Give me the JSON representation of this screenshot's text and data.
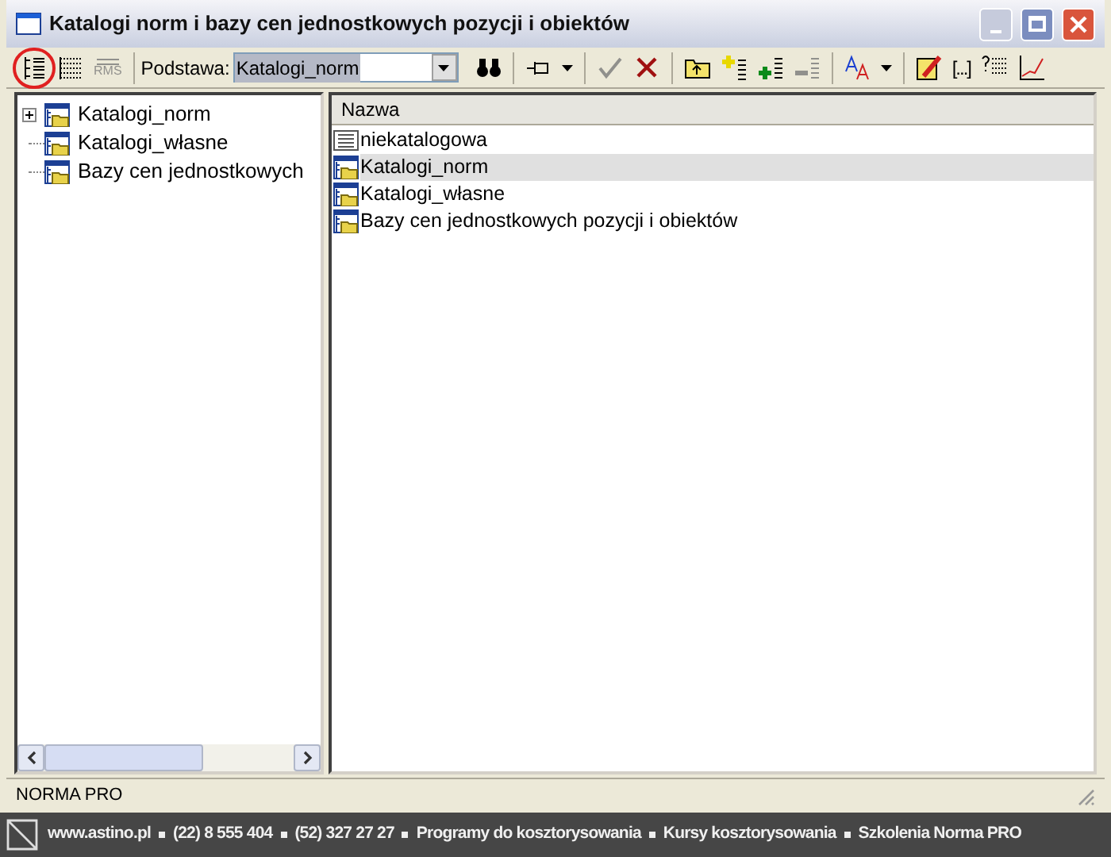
{
  "window": {
    "title": "Katalogi norm i bazy cen jednostkowych pozycji i obiektów"
  },
  "toolbar": {
    "groups": [
      [
        {
          "kind": "tree",
          "disabled": false,
          "circled": true
        },
        {
          "kind": "grid",
          "disabled": false,
          "circled": false
        },
        {
          "kind": "rms",
          "label": "RMS",
          "disabled": true,
          "circled": false
        }
      ],
      [
        {
          "kind": "base"
        }
      ],
      [
        {
          "kind": "pin",
          "dropdown": true,
          "disabled": false,
          "circled": false
        }
      ],
      [
        {
          "kind": "check",
          "disabled": true,
          "circled": false
        },
        {
          "kind": "cross",
          "disabled": false,
          "circled": false
        }
      ],
      [
        {
          "kind": "folder-up",
          "disabled": false,
          "circled": false
        },
        {
          "kind": "add-yellow",
          "disabled": false,
          "circled": false
        },
        {
          "kind": "add-green",
          "disabled": false,
          "circled": false
        },
        {
          "kind": "remove",
          "disabled": true,
          "circled": false
        }
      ],
      [
        {
          "kind": "font",
          "dropdown": true,
          "disabled": false,
          "circled": false
        }
      ],
      [
        {
          "kind": "edit",
          "disabled": false,
          "circled": false
        },
        {
          "kind": "brackets",
          "label": "[...]",
          "disabled": false,
          "circled": false
        },
        {
          "kind": "query",
          "disabled": false,
          "circled": false
        },
        {
          "kind": "chart",
          "disabled": false,
          "circled": false
        }
      ]
    ],
    "base_label": "Podstawa:",
    "base_value": "Katalogi_norm"
  },
  "tree": {
    "items": [
      {
        "label": "Katalogi_norm",
        "expander": true
      },
      {
        "label": "Katalogi_własne",
        "expander": false
      },
      {
        "label": "Bazy cen jednostkowych",
        "expander": false
      }
    ]
  },
  "list": {
    "column": "Nazwa",
    "rows": [
      {
        "kind": "list",
        "label": "niekatalogowa",
        "selected": false
      },
      {
        "kind": "folder",
        "label": "Katalogi_norm",
        "selected": true
      },
      {
        "kind": "folder",
        "label": "Katalogi_własne",
        "selected": false
      },
      {
        "kind": "folder",
        "label": "Bazy cen jednostkowych pozycji i obiektów",
        "selected": false
      }
    ]
  },
  "status_bar": {
    "text": "NORMA PRO"
  },
  "footer": {
    "items": [
      "www.astino.pl",
      "(22) 8 555 404",
      "(52) 327 27 27",
      "Programy do kosztorysowania",
      "Kursy kosztorysowania",
      "Szkolenia Norma PRO"
    ]
  }
}
